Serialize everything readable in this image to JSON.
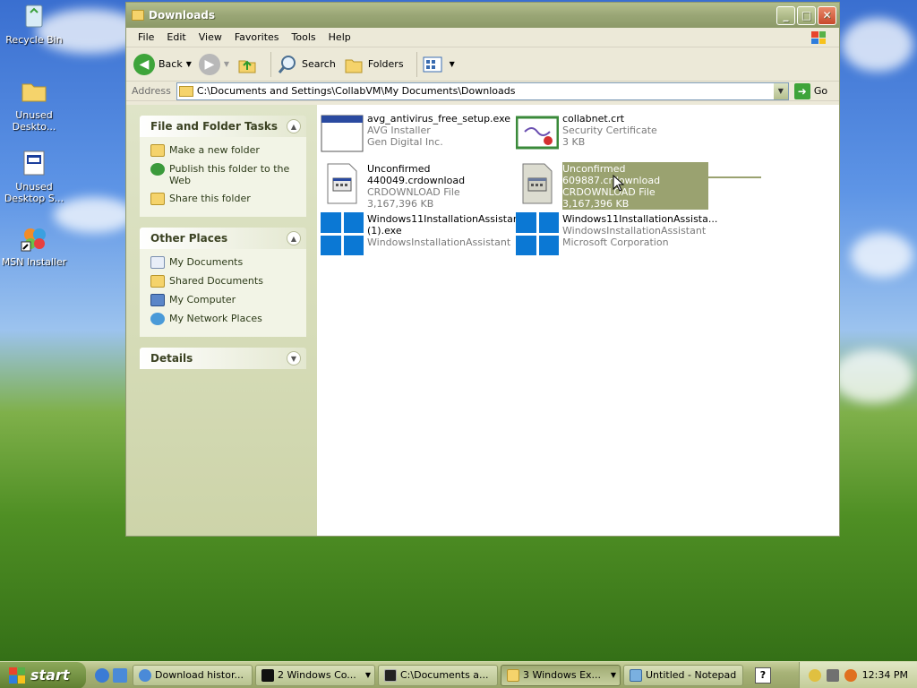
{
  "desktop": {
    "icons": [
      {
        "label": "Recycle Bin",
        "icon": "recycle-bin-icon"
      },
      {
        "label": "Unused Deskto...",
        "icon": "folder-icon"
      },
      {
        "label": "Unused Desktop S...",
        "icon": "shortcut-window-icon"
      },
      {
        "label": "MSN Installer",
        "icon": "msn-butterfly-icon"
      }
    ]
  },
  "window": {
    "title": "Downloads",
    "menu": [
      "File",
      "Edit",
      "View",
      "Favorites",
      "Tools",
      "Help"
    ],
    "toolbar": {
      "back": "Back",
      "search": "Search",
      "folders": "Folders"
    },
    "address": {
      "label": "Address",
      "value": "C:\\Documents and Settings\\CollabVM\\My Documents\\Downloads",
      "go": "Go"
    },
    "left": {
      "tasks_title": "File and Folder Tasks",
      "tasks": [
        {
          "label": "Make a new folder",
          "icon": "new-folder-icon"
        },
        {
          "label": "Publish this folder to the Web",
          "icon": "globe-icon"
        },
        {
          "label": "Share this folder",
          "icon": "share-folder-icon"
        }
      ],
      "places_title": "Other Places",
      "places": [
        {
          "label": "My Documents",
          "icon": "my-documents-icon"
        },
        {
          "label": "Shared Documents",
          "icon": "folder-icon"
        },
        {
          "label": "My Computer",
          "icon": "computer-icon"
        },
        {
          "label": "My Network Places",
          "icon": "network-icon"
        }
      ],
      "details_title": "Details"
    },
    "files": [
      {
        "name": "avg_antivirus_free_setup.exe",
        "line2": "AVG Installer",
        "line3": "Gen Digital Inc.",
        "icon": "installer-window-icon"
      },
      {
        "name": "collabnet.crt",
        "line2": "Security Certificate",
        "line3": "3 KB",
        "icon": "certificate-icon"
      },
      {
        "name": "Unconfirmed 440049.crdownload",
        "line2": "CRDOWNLOAD File",
        "line3": "3,167,396 KB",
        "icon": "unknown-file-icon"
      },
      {
        "name": "Unconfirmed 609887.crdownload",
        "line2": "CRDOWNLOAD File",
        "line3": "3,167,396 KB",
        "icon": "unknown-file-icon",
        "selected": true
      },
      {
        "name": "Windows11InstallationAssistant (1).exe",
        "line2": "WindowsInstallationAssistant",
        "line3": "",
        "icon": "windows11-logo-icon"
      },
      {
        "name": "Windows11InstallationAssista...",
        "line2": "WindowsInstallationAssistant",
        "line3": "Microsoft Corporation",
        "icon": "windows11-logo-icon"
      }
    ]
  },
  "taskbar": {
    "start": "start",
    "buttons": [
      {
        "label": "Download histor...",
        "icon": "chrome-icon"
      },
      {
        "label": "2 Windows Co...",
        "icon": "cmd-icon"
      },
      {
        "label": "C:\\Documents a...",
        "icon": "7zip-icon"
      },
      {
        "label": "3 Windows Ex...",
        "icon": "folder-icon",
        "active": true
      },
      {
        "label": "Untitled - Notepad",
        "icon": "notepad-icon"
      }
    ],
    "clock": "12:34 PM"
  }
}
